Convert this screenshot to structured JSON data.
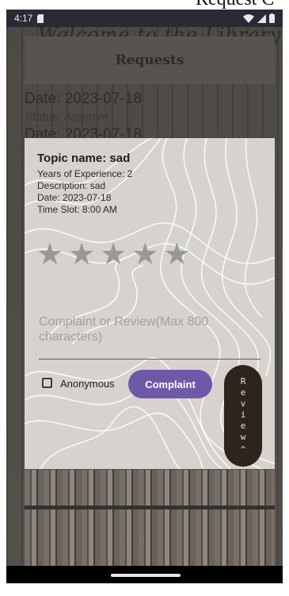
{
  "page": {
    "cut_title": "Request C"
  },
  "status_bar": {
    "time": "4:17"
  },
  "background": {
    "cursive_text": "Welcome to the Library",
    "app_title": "Requests",
    "list_date": "Date: 2023-07-18",
    "list_status": "Status: Approve",
    "list_date_partial": "Date: 2023-07-18"
  },
  "dialog": {
    "topic": "Topic name: sad",
    "years": "Years of Experience: 2",
    "description": "Description: sad",
    "date": "Date: 2023-07-18",
    "time_slot": "Time Slot: 8:00 AM",
    "rating": {
      "value": 0,
      "max": 5
    },
    "complaint_placeholder": "Complaint or Review(Max 800 characters)",
    "anonymous_label": "Anonymous",
    "anonymous_checked": false,
    "complaint_button": "Complaint",
    "review_button": "Review"
  },
  "colors": {
    "accent": "#6e58a8",
    "review_button": "#2d241c",
    "dialog_bg": "#d6d2cd"
  }
}
